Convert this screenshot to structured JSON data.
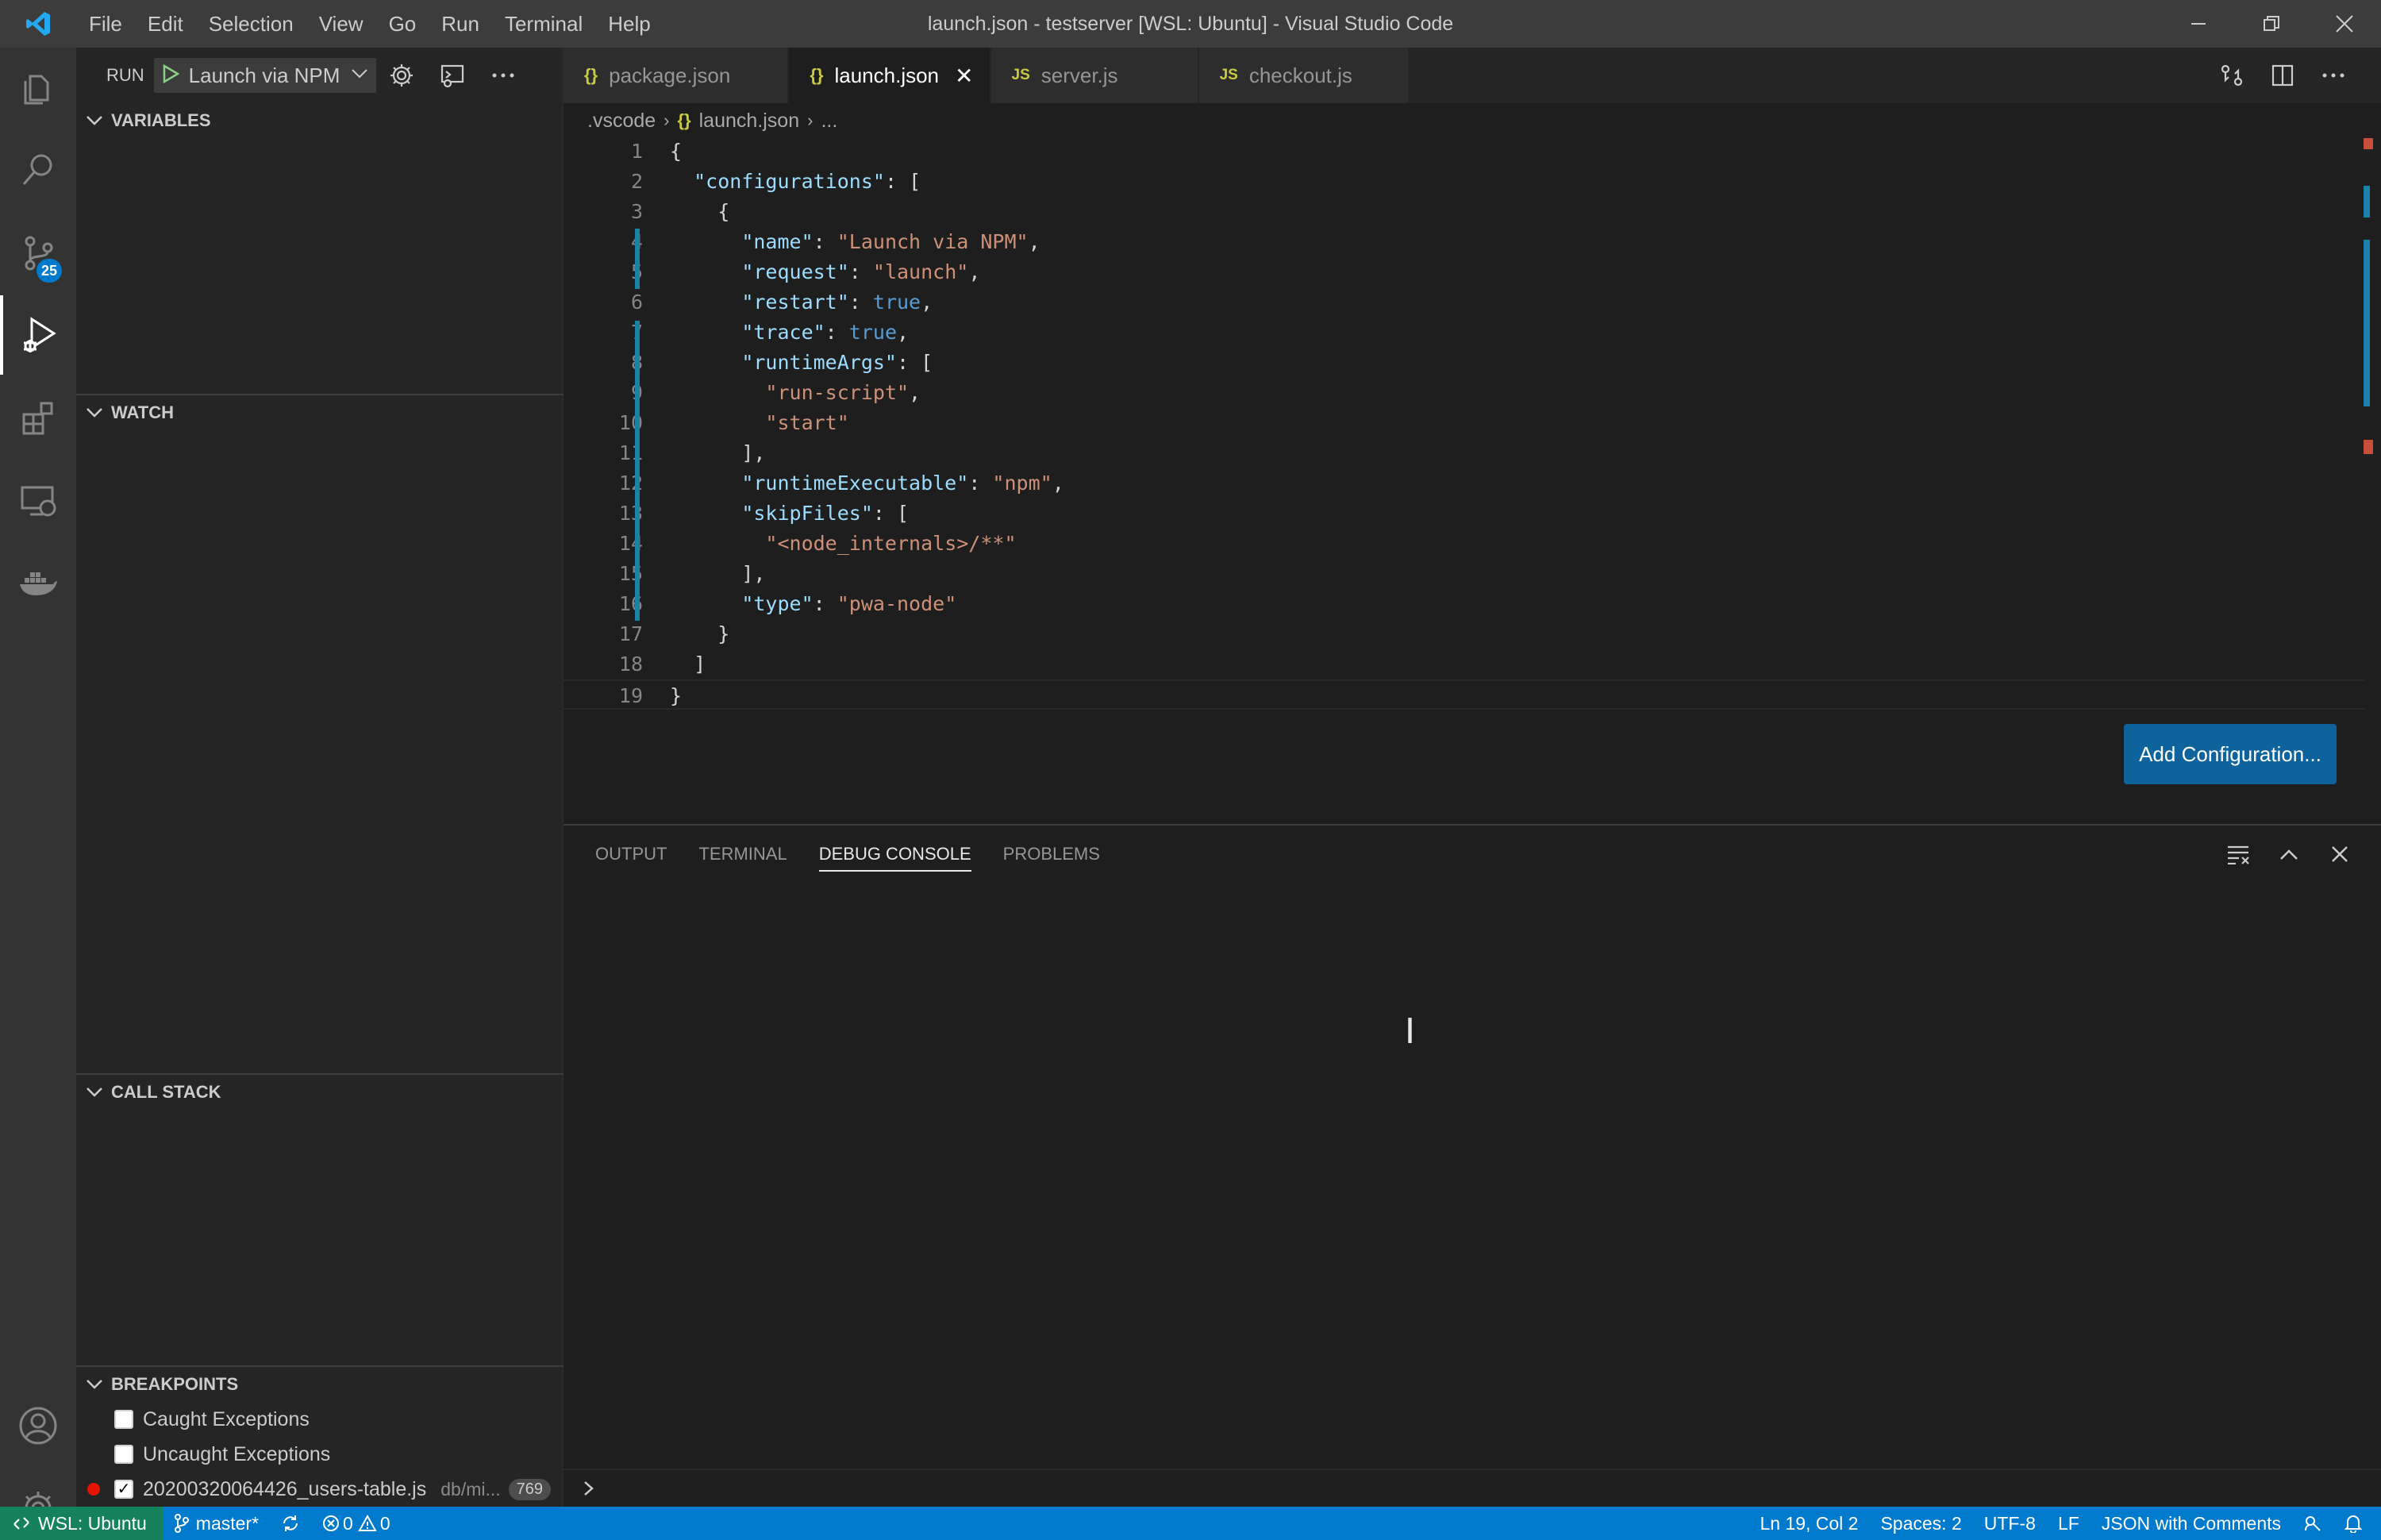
{
  "window": {
    "title": "launch.json - testserver [WSL: Ubuntu] - Visual Studio Code"
  },
  "menu": [
    "File",
    "Edit",
    "Selection",
    "View",
    "Go",
    "Run",
    "Terminal",
    "Help"
  ],
  "activity_bar": {
    "scm_badge": "25"
  },
  "run": {
    "label": "RUN",
    "config": "Launch via NPM"
  },
  "sections": {
    "variables": "VARIABLES",
    "watch": "WATCH",
    "call_stack": "CALL STACK",
    "breakpoints": "BREAKPOINTS"
  },
  "breakpoints": [
    {
      "label": "Caught Exceptions",
      "checked": false
    },
    {
      "label": "Uncaught Exceptions",
      "checked": false
    },
    {
      "label": "20200320064426_users-table.js",
      "checked": true,
      "path": "db/mi...",
      "line": "769"
    }
  ],
  "tabs": [
    {
      "label": "package.json",
      "icon": "{}",
      "active": false
    },
    {
      "label": "launch.json",
      "icon": "{}",
      "active": true
    },
    {
      "label": "server.js",
      "icon": "JS",
      "active": false
    },
    {
      "label": "checkout.js",
      "icon": "JS",
      "active": false
    }
  ],
  "breadcrumb": {
    "folder": ".vscode",
    "file": "launch.json",
    "more": "..."
  },
  "code_lines": [
    "{",
    "  \"configurations\": [",
    "    {",
    "      \"name\": \"Launch via NPM\",",
    "      \"request\": \"launch\",",
    "      \"restart\": true,",
    "      \"trace\": true,",
    "      \"runtimeArgs\": [",
    "        \"run-script\",",
    "        \"start\"",
    "      ],",
    "      \"runtimeExecutable\": \"npm\",",
    "      \"skipFiles\": [",
    "        \"<node_internals>/**\"",
    "      ],",
    "      \"type\": \"pwa-node\"",
    "    }",
    "  ]",
    "}"
  ],
  "add_config_button": "Add Configuration...",
  "panel": {
    "tabs": [
      "OUTPUT",
      "TERMINAL",
      "DEBUG CONSOLE",
      "PROBLEMS"
    ],
    "active_tab": "DEBUG CONSOLE"
  },
  "status": {
    "remote": "WSL: Ubuntu",
    "branch": "master*",
    "errors": "0",
    "warnings": "0",
    "position": "Ln 19, Col 2",
    "spaces": "Spaces: 2",
    "encoding": "UTF-8",
    "eol": "LF",
    "language": "JSON with Comments"
  }
}
